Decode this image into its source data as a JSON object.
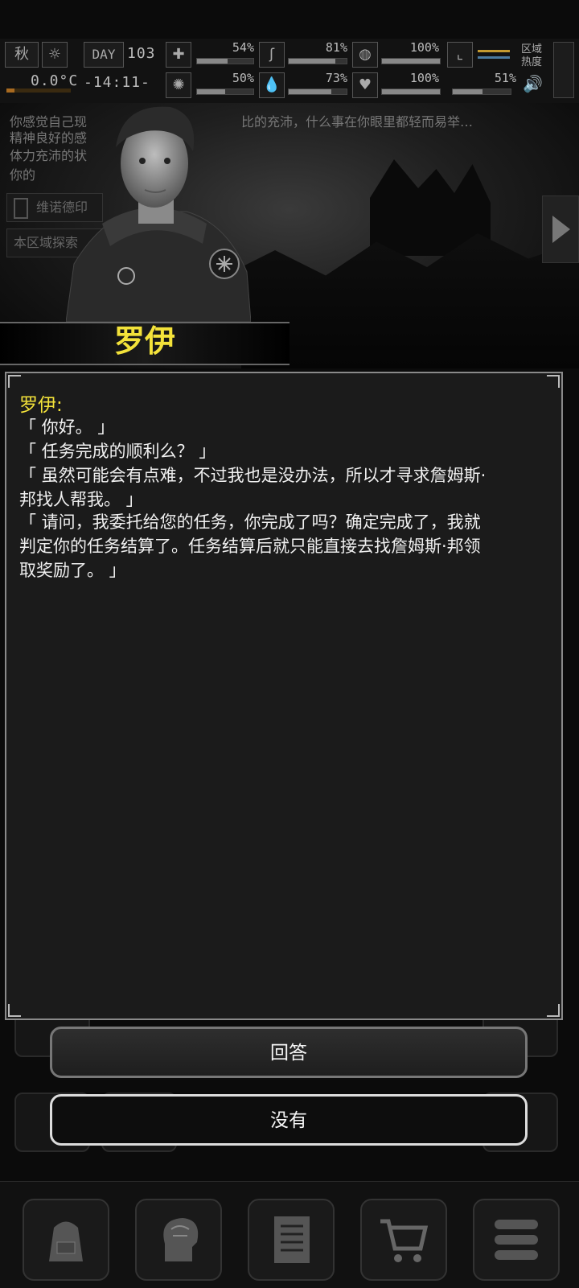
{
  "status": {
    "season": "秋",
    "day_label": "DAY",
    "day_value": "103",
    "temperature": "0.0°C",
    "time": "-14:11-",
    "stats_top": [
      "54%",
      "81%",
      "100%"
    ],
    "stats_bottom": [
      "50%",
      "73%",
      "100%",
      "51%"
    ],
    "stats_top_fill": [
      0.54,
      0.81,
      1.0
    ],
    "stats_bottom_fill": [
      0.5,
      0.73,
      1.0,
      0.51
    ],
    "zone_heat_label": "区域\n热度"
  },
  "background": {
    "log_lines": [
      "你感觉自己现",
      "比的充沛，什么事在你眼里都轻而易举…",
      "精神良好的感",
      "体力充沛的状",
      "你的"
    ],
    "panel1": "维诺德印",
    "panel2": "本区域探索"
  },
  "npc": {
    "name": "罗伊"
  },
  "dialog": {
    "speaker": "罗伊:",
    "lines": [
      "「 你好。 」",
      "「 任务完成的顺利么？ 」",
      "「 虽然可能会有点难，不过我也是没办法，所以才寻求詹姆斯·",
      "邦找人帮我。 」",
      "「 请问，我委托给您的任务，你完成了吗？确定完成了，我就",
      "判定你的任务结算了。任务结算后就只能直接去找詹姆斯·邦领",
      "取奖励了。 」"
    ]
  },
  "choices": {
    "answer": "回答",
    "none": "没有"
  },
  "nav": {
    "icons": [
      "backpack-icon",
      "brain-icon",
      "notebook-icon",
      "cart-icon",
      "menu-icon"
    ]
  },
  "colors": {
    "accent_yellow": "#f3e23a",
    "dialog_bg": "#1b1b1b",
    "text": "#f0f0f0"
  }
}
